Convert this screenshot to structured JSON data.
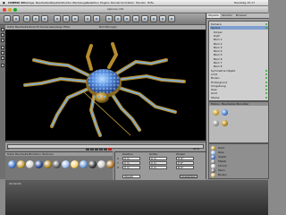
{
  "menubar": {
    "app_name": "CINEMA 4D",
    "items": [
      "Ablage",
      "Bearbeiten",
      "Objekte",
      "Struktur",
      "Werkzeuge",
      "Selektion",
      "Plugins",
      "Render",
      "Animation",
      "Fenster",
      "Hilfe"
    ],
    "clock": "Dienstag  15:17"
  },
  "window": {
    "title": "spinnen.c4d"
  },
  "viewport": {
    "title": "Bild-Manager",
    "menu": [
      "Datei",
      "Bearbeiten",
      "Ansicht",
      "Kameras",
      "Anzeige",
      "Filter"
    ],
    "background": "#000000"
  },
  "timeline": {
    "start": "0",
    "end": "90 B"
  },
  "materials": {
    "tabs": [
      "Datei",
      "Bearbeiten",
      "Funktion",
      "Texturen"
    ],
    "swatch_colors": [
      "#4a7fd1",
      "#c9a23a",
      "#d6d6d6",
      "#2f4f9a",
      "#b58b2b",
      "#5e5e5e",
      "#9fc0f0",
      "#ffd36a",
      "#6ea0e0",
      "#3b3b3b",
      "#cccccc",
      "#b0782a"
    ]
  },
  "coordinates": {
    "headers": [
      "Position",
      "Größe",
      "Winkel"
    ],
    "rows": [
      {
        "axis": "X",
        "pos": "0 m",
        "size": "0 m",
        "rot": "H 0°"
      },
      {
        "axis": "Y",
        "pos": "0 m",
        "size": "0 m",
        "rot": "P 0°"
      },
      {
        "axis": "Z",
        "pos": "0 m",
        "size": "0 m",
        "rot": "B 0°"
      }
    ],
    "mode": "Objekt",
    "apply": "Anwenden"
  },
  "right_panel": {
    "tabs": [
      "Objekte",
      "Struktur",
      "Browser"
    ],
    "objects": [
      "Kamera",
      "Spinne",
      "Körper",
      "Kopf",
      "Bein 1",
      "Bein 2",
      "Bein 3",
      "Bein 4",
      "Bein 5",
      "Bein 6",
      "Bein 7",
      "Bein 8",
      "Symmetrie Objekt",
      "Licht",
      "Boden",
      "Hintergrund",
      "Umgebung",
      "Glas",
      "Gold",
      "Steine"
    ],
    "attr_tabs": [
      "Modus",
      "Bearbeiten",
      "Benutzer"
    ],
    "materials": [
      "Gold",
      "Glas",
      "Saphir",
      "Metall",
      "Chrom",
      "Stein",
      "Boden"
    ],
    "material_colors": [
      "#c9a23a",
      "#9fc0f0",
      "#3e6fd0",
      "#8a8a8a",
      "#dcdcdc",
      "#6b6b6b",
      "#e0c070"
    ]
  },
  "status": {
    "text": "00:00:00"
  }
}
